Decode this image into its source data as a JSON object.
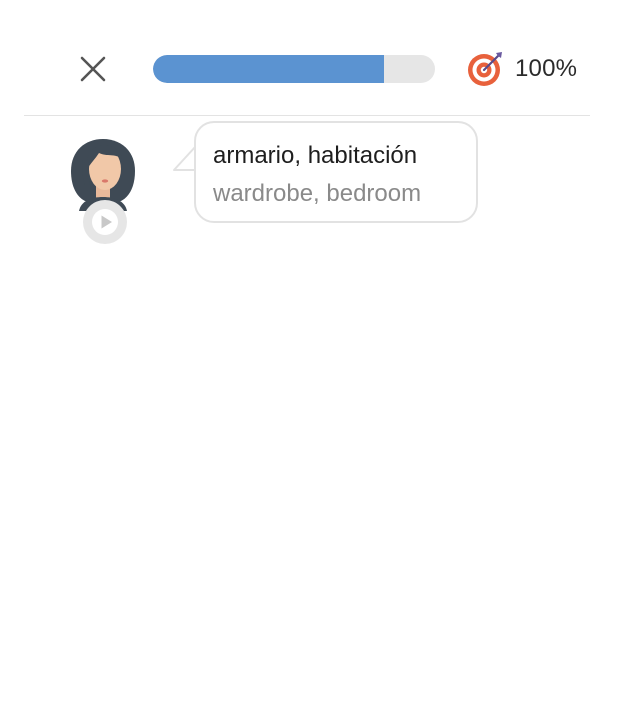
{
  "header": {
    "close_icon": "close-icon",
    "progress_fraction": 0.82,
    "progress_color": "#5b93d1",
    "progress_track_color": "#e6e6e6",
    "goal_icon": "target-icon",
    "goal_percent": "100%"
  },
  "lesson": {
    "speaker_avatar": "avatar-woman",
    "play_icon": "play-icon",
    "phrase": "armario, habitación",
    "translation": "wardrobe, bedroom"
  }
}
